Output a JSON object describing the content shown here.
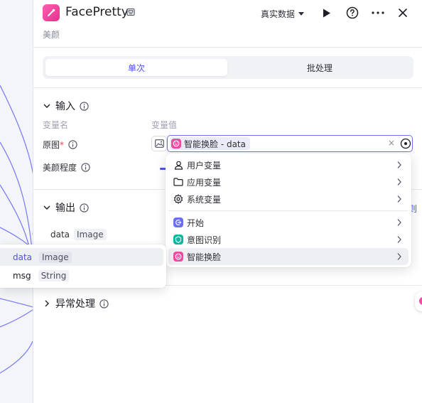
{
  "app": {
    "title": "FacePretty",
    "subtitle": "美颜",
    "mode_label": "真实数据"
  },
  "tabs": [
    {
      "label": "单次",
      "active": true
    },
    {
      "label": "批处理",
      "active": false
    }
  ],
  "input_section": {
    "title": "输入",
    "col_name": "变量名",
    "col_value": "变量值",
    "fields": [
      {
        "label": "原图",
        "required": true,
        "value_tag": "智能换脸 - data"
      },
      {
        "label": "美颜程度",
        "required": false
      }
    ]
  },
  "output_section": {
    "title": "输出",
    "rows": [
      {
        "name": "data",
        "type": "Image"
      }
    ],
    "link_fragment": "则"
  },
  "error_section": {
    "title": "异常处理"
  },
  "dropdown": {
    "items": [
      {
        "label": "用户变量",
        "icon": "user-icon"
      },
      {
        "label": "应用变量",
        "icon": "folder-icon"
      },
      {
        "label": "系统变量",
        "icon": "gear-icon"
      },
      {
        "label": "开始",
        "icon": "start-node-icon"
      },
      {
        "label": "意图识别",
        "icon": "intent-node-icon"
      },
      {
        "label": "智能换脸",
        "icon": "faceswap-node-icon",
        "hovered": true
      }
    ]
  },
  "output_popup": {
    "rows": [
      {
        "name": "data",
        "type": "Image",
        "selected": true
      },
      {
        "name": "msg",
        "type": "String",
        "selected": false
      }
    ]
  },
  "colors": {
    "accent": "#4d53e8",
    "brand_pink": "#ee4aa1",
    "start_node": "#6b70f2",
    "intent_node": "#0fb5a0",
    "required": "#f33f4c"
  }
}
